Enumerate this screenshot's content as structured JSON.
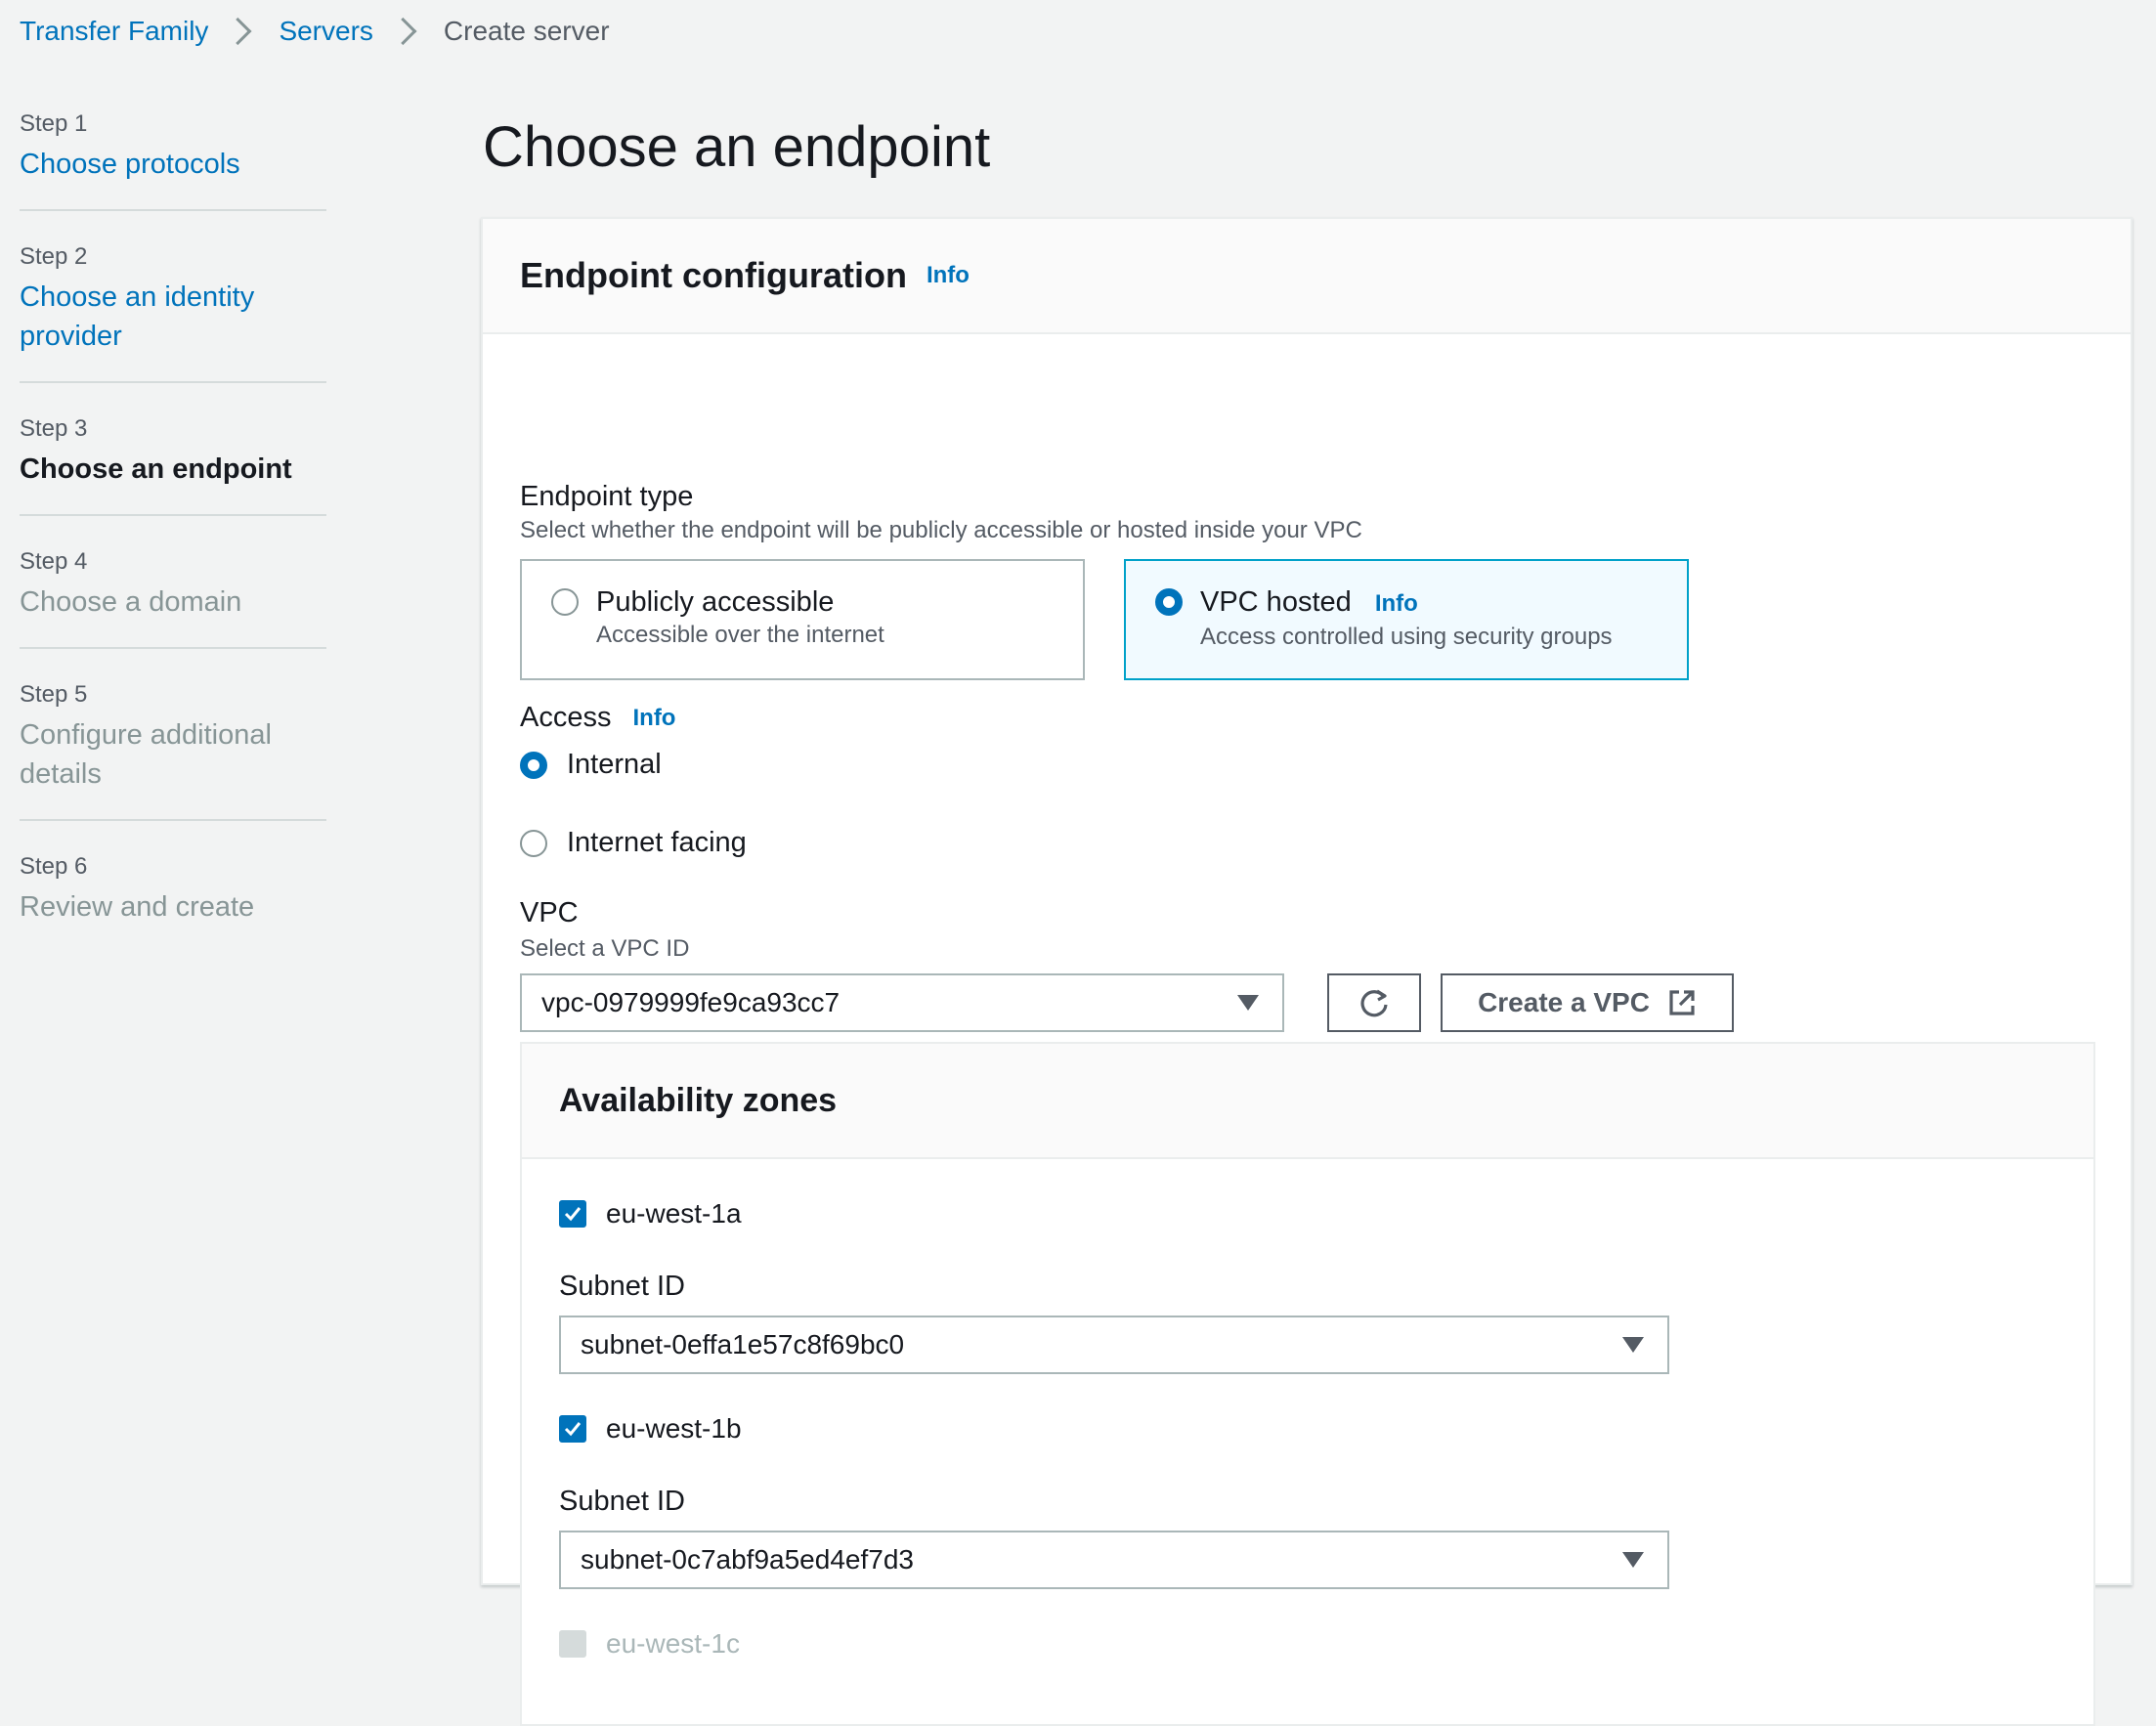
{
  "breadcrumb": {
    "items": [
      "Transfer Family",
      "Servers",
      "Create server"
    ]
  },
  "steps": [
    {
      "num": "Step 1",
      "title": "Choose protocols",
      "state": "link"
    },
    {
      "num": "Step 2",
      "title": "Choose an identity provider",
      "state": "link"
    },
    {
      "num": "Step 3",
      "title": "Choose an endpoint",
      "state": "active"
    },
    {
      "num": "Step 4",
      "title": "Choose a domain",
      "state": "disabled"
    },
    {
      "num": "Step 5",
      "title": "Configure additional details",
      "state": "disabled"
    },
    {
      "num": "Step 6",
      "title": "Review and create",
      "state": "disabled"
    }
  ],
  "page_title": "Choose an endpoint",
  "endpoint_config": {
    "header": "Endpoint configuration",
    "info": "Info",
    "endpoint_type": {
      "label": "Endpoint type",
      "description": "Select whether the endpoint will be publicly accessible or hosted inside your VPC",
      "options": [
        {
          "title": "Publicly accessible",
          "description": "Accessible over the internet",
          "selected": false
        },
        {
          "title": "VPC hosted",
          "info": "Info",
          "description": "Access controlled using security groups",
          "selected": true
        }
      ]
    },
    "access": {
      "label": "Access",
      "info": "Info",
      "options": [
        {
          "label": "Internal",
          "selected": true
        },
        {
          "label": "Internet facing",
          "selected": false
        }
      ]
    },
    "vpc": {
      "label": "VPC",
      "description": "Select a VPC ID",
      "value": "vpc-0979999fe9ca93cc7",
      "create_button": "Create a VPC"
    },
    "availability_zones": {
      "header": "Availability zones",
      "zones": [
        {
          "name": "eu-west-1a",
          "checked": true,
          "subnet_label": "Subnet ID",
          "subnet": "subnet-0effa1e57c8f69bc0"
        },
        {
          "name": "eu-west-1b",
          "checked": true,
          "subnet_label": "Subnet ID",
          "subnet": "subnet-0c7abf9a5ed4ef7d3"
        },
        {
          "name": "eu-west-1c",
          "checked": false,
          "disabled": true
        }
      ]
    }
  },
  "colors": {
    "link": "#0073bb",
    "selected_tile_bg": "#f1faff",
    "selected_tile_border": "#00a1c9",
    "page_bg": "#f2f3f3"
  }
}
